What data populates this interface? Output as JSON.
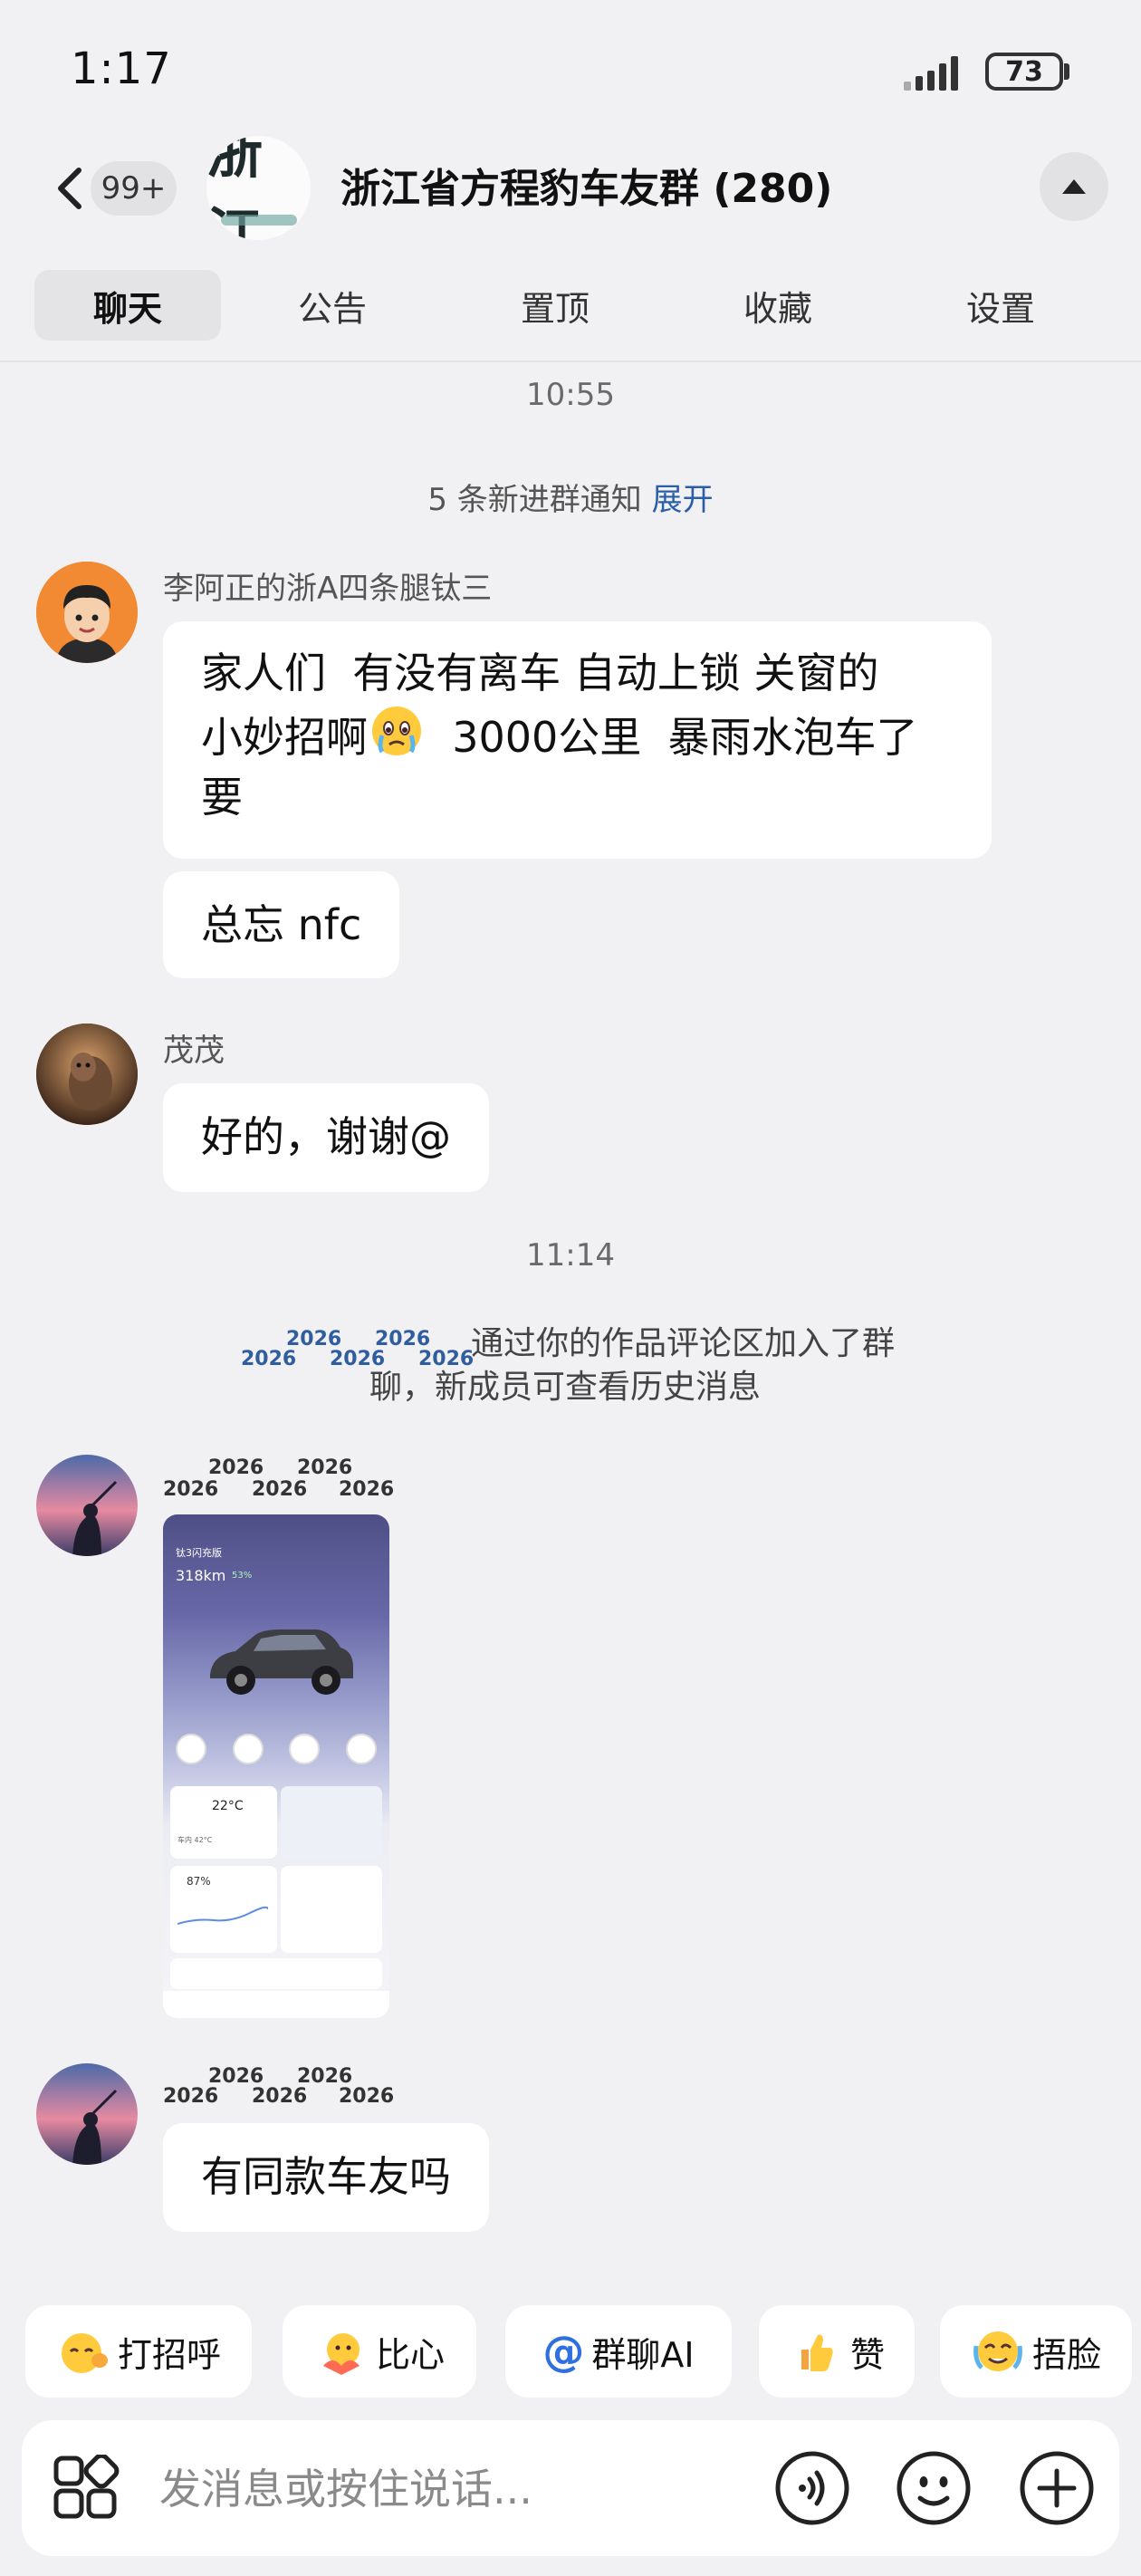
{
  "status_bar": {
    "time": "1:17",
    "battery": "73"
  },
  "header": {
    "unread_count": "99+",
    "group_avatar_text": "浙江",
    "group_title": "浙江省方程豹车友群 (280)"
  },
  "tabs": [
    {
      "label": "聊天"
    },
    {
      "label": "公告"
    },
    {
      "label": "置顶"
    },
    {
      "label": "收藏"
    },
    {
      "label": "设置"
    }
  ],
  "chat": {
    "timestamp_1": "10:55",
    "join_notice": {
      "text": "5 条新进群通知",
      "action": "展开"
    },
    "msg1": {
      "sender": "李阿正的浙A四条腿钛三",
      "text_a": "家人们  有没有离车 自动上锁 关窗的",
      "text_b": "小妙招啊",
      "text_c": "  3000公里  暴雨水泡车了",
      "text_d": "要",
      "text_2": "总忘 nfc"
    },
    "msg2": {
      "sender": "茂茂",
      "text": "好的，谢谢@"
    },
    "timestamp_2": "11:14",
    "join_event": {
      "line1": "通过你的作品评论区加入了群",
      "line2": "聊，新成员可查看历史消息"
    },
    "decor_year": "2026",
    "msg3": {
      "phone_ui": {
        "model": "钛3闪充版",
        "range": "318km",
        "battery_pct": "53%",
        "temp": "22°C",
        "eco": "87%",
        "car_temp": "车内 42°C"
      }
    },
    "msg4": {
      "text": "有同款车友吗"
    }
  },
  "quick_replies": [
    {
      "label": "打招呼"
    },
    {
      "label": "比心"
    },
    {
      "label": "群聊AI"
    },
    {
      "label": "赞"
    },
    {
      "label": "捂脸"
    }
  ],
  "input": {
    "placeholder": "发消息或按住说话..."
  }
}
